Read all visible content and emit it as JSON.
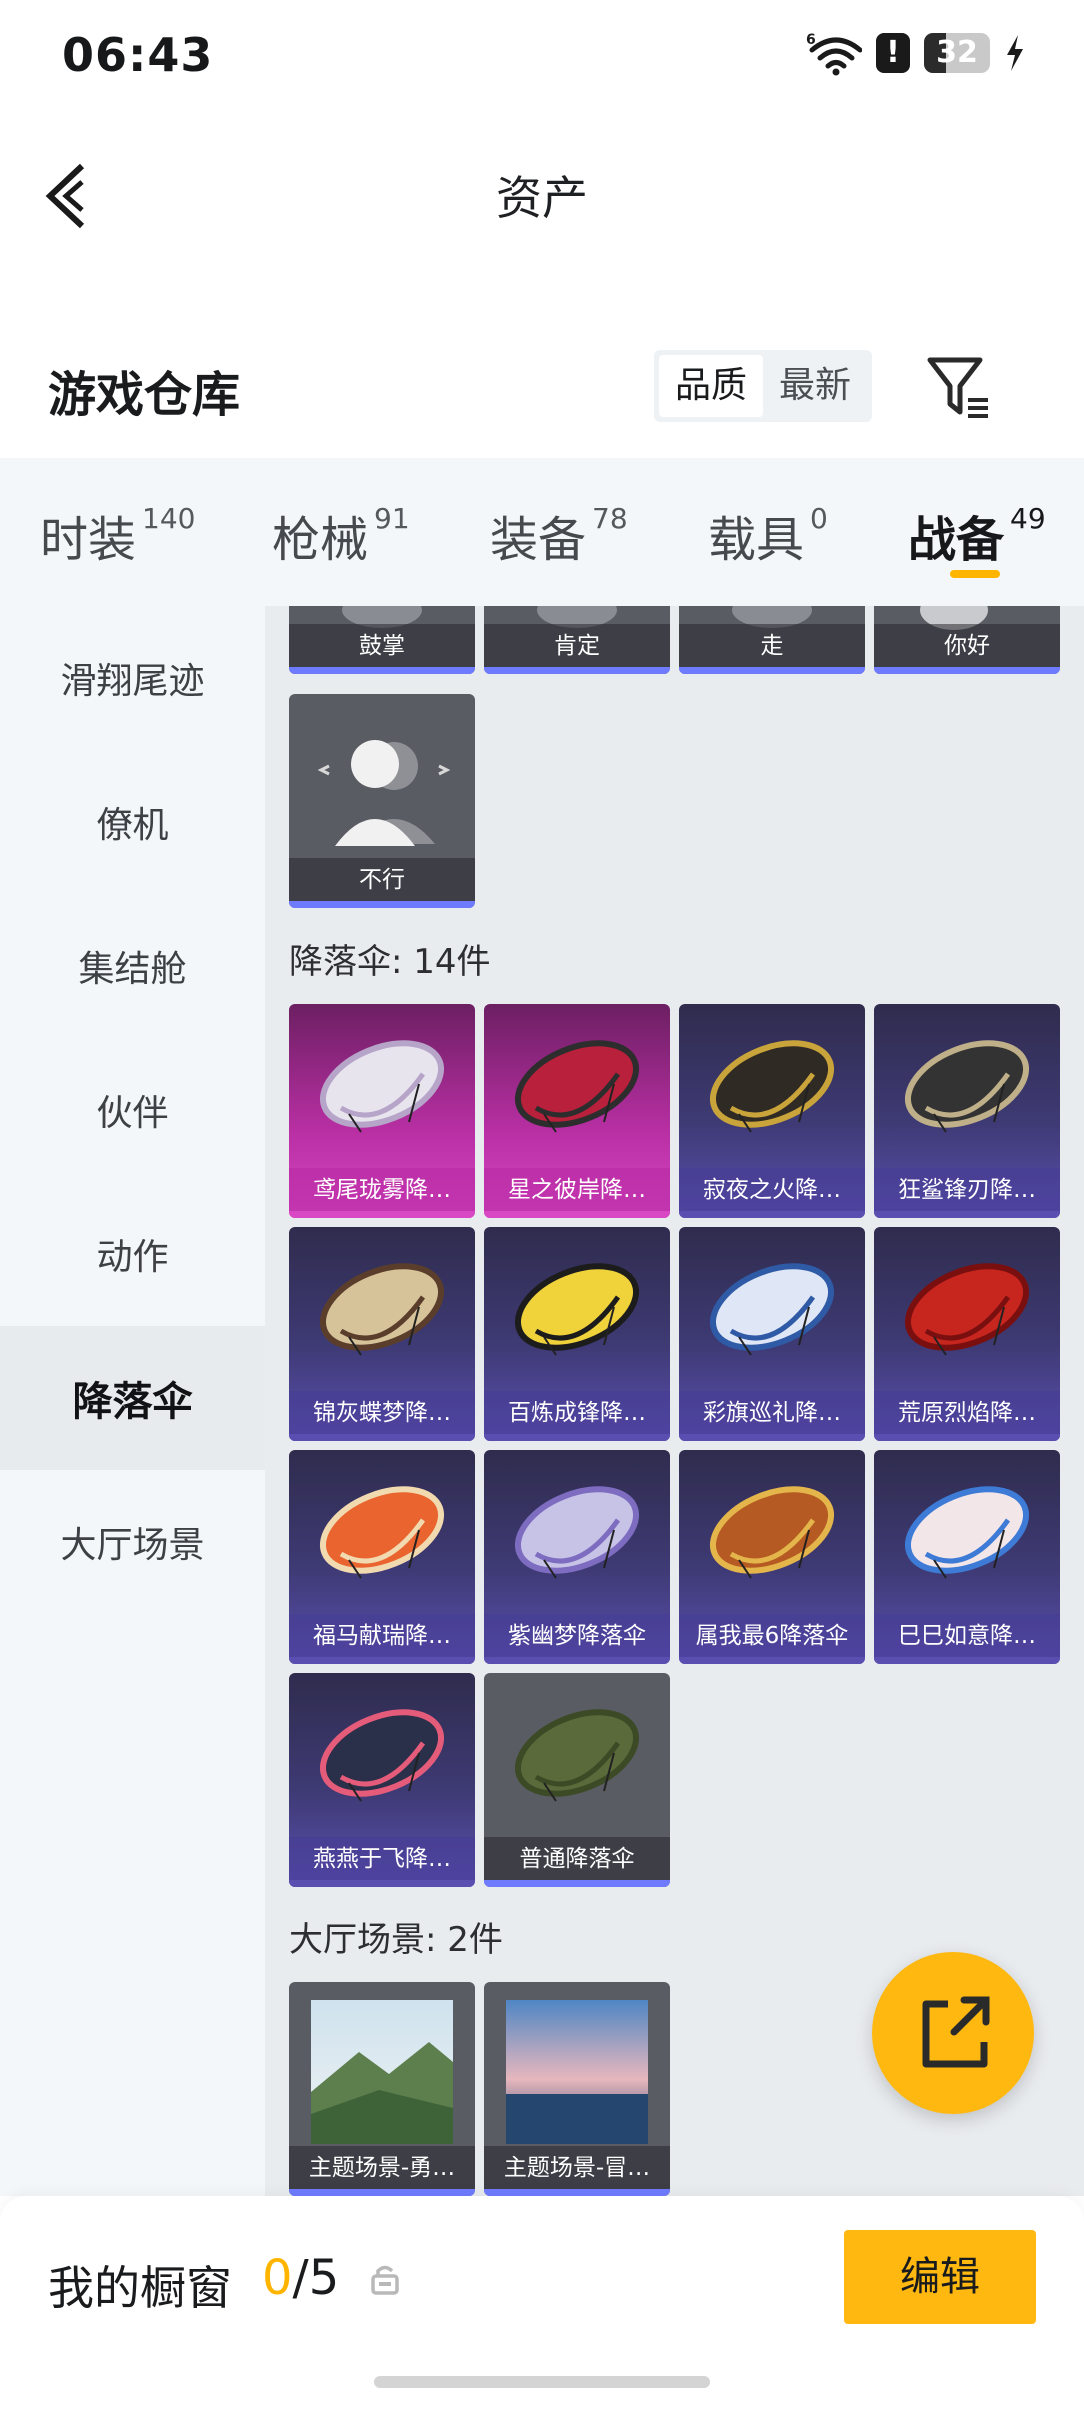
{
  "status_bar": {
    "time": "06:43",
    "battery": "32"
  },
  "header": {
    "title": "资产"
  },
  "warehouse": {
    "title": "游戏仓库",
    "sort_options": [
      "品质",
      "最新"
    ],
    "active_sort": "品质"
  },
  "tabs": [
    {
      "label": "时装",
      "count": "140"
    },
    {
      "label": "枪械",
      "count": "91"
    },
    {
      "label": "装备",
      "count": "78"
    },
    {
      "label": "载具",
      "count": "0"
    },
    {
      "label": "战备",
      "count": "49",
      "active": true
    }
  ],
  "sidebar": {
    "items": [
      "滑翔尾迹",
      "僚机",
      "集结舱",
      "伙伴",
      "动作",
      "降落伞",
      "大厅场景"
    ],
    "active": "降落伞"
  },
  "emotes": {
    "items": [
      {
        "name": "鼓掌"
      },
      {
        "name": "肯定"
      },
      {
        "name": "走"
      },
      {
        "name": "你好"
      },
      {
        "name": "不行"
      }
    ]
  },
  "parachutes": {
    "title": "降落伞: 14件",
    "items": [
      {
        "name": "鸢尾珑雾降…",
        "rarity": "pink"
      },
      {
        "name": "星之彼岸降…",
        "rarity": "pink"
      },
      {
        "name": "寂夜之火降…",
        "rarity": "purple"
      },
      {
        "name": "狂鲨锋刃降…",
        "rarity": "purple"
      },
      {
        "name": "锦灰蝶梦降…",
        "rarity": "purple"
      },
      {
        "name": "百炼成锋降…",
        "rarity": "purple"
      },
      {
        "name": "彩旗巡礼降…",
        "rarity": "purple"
      },
      {
        "name": "荒原烈焰降…",
        "rarity": "purple"
      },
      {
        "name": "福马献瑞降…",
        "rarity": "purple"
      },
      {
        "name": "紫幽梦降落伞",
        "rarity": "purple"
      },
      {
        "name": "属我最6降落伞",
        "rarity": "purple"
      },
      {
        "name": "巳巳如意降…",
        "rarity": "purple"
      },
      {
        "name": "燕燕于飞降…",
        "rarity": "purple"
      },
      {
        "name": "普通降落伞",
        "rarity": "gray"
      }
    ]
  },
  "lobby_scenes": {
    "title": "大厅场景: 2件",
    "items": [
      {
        "name": "主题场景-勇…"
      },
      {
        "name": "主题场景-冒…"
      }
    ]
  },
  "showcase": {
    "label": "我的橱窗",
    "used": "0",
    "total": "/5",
    "edit_label": "编辑"
  },
  "colors": {
    "accent": "#ffb810",
    "rarity_blue": "#6f7bff",
    "pink": "#d848c4",
    "purple": "#5a4fb0"
  }
}
